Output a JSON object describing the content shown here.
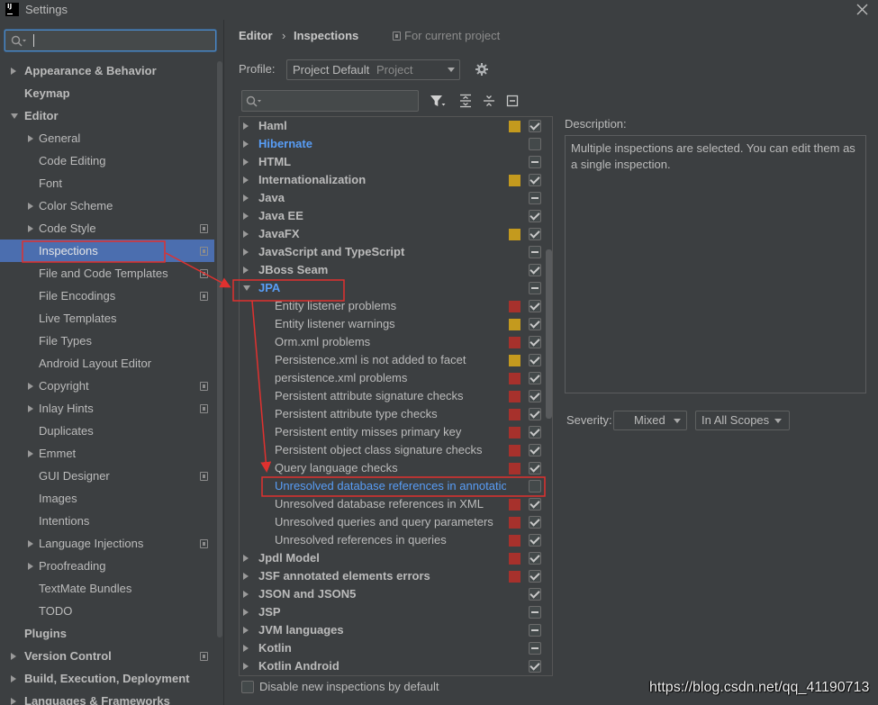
{
  "window": {
    "logo_text": "IJ",
    "title": "Settings"
  },
  "sidebar_search": {
    "value": ""
  },
  "sidebar": {
    "items": [
      {
        "label": "Appearance & Behavior",
        "level": 0,
        "state": "collapsed"
      },
      {
        "label": "Keymap",
        "level": 0
      },
      {
        "label": "Editor",
        "level": 0,
        "state": "expanded"
      },
      {
        "label": "General",
        "level": 1,
        "state": "collapsed"
      },
      {
        "label": "Code Editing",
        "level": 1
      },
      {
        "label": "Font",
        "level": 1
      },
      {
        "label": "Color Scheme",
        "level": 1,
        "state": "collapsed"
      },
      {
        "label": "Code Style",
        "level": 1,
        "state": "collapsed",
        "project_icon": true
      },
      {
        "label": "Inspections",
        "level": 1,
        "project_icon": true,
        "selected": true
      },
      {
        "label": "File and Code Templates",
        "level": 1,
        "project_icon": true
      },
      {
        "label": "File Encodings",
        "level": 1,
        "project_icon": true
      },
      {
        "label": "Live Templates",
        "level": 1
      },
      {
        "label": "File Types",
        "level": 1
      },
      {
        "label": "Android Layout Editor",
        "level": 1
      },
      {
        "label": "Copyright",
        "level": 1,
        "state": "collapsed",
        "project_icon": true
      },
      {
        "label": "Inlay Hints",
        "level": 1,
        "state": "collapsed",
        "project_icon": true
      },
      {
        "label": "Duplicates",
        "level": 1
      },
      {
        "label": "Emmet",
        "level": 1,
        "state": "collapsed"
      },
      {
        "label": "GUI Designer",
        "level": 1,
        "project_icon": true
      },
      {
        "label": "Images",
        "level": 1
      },
      {
        "label": "Intentions",
        "level": 1
      },
      {
        "label": "Language Injections",
        "level": 1,
        "state": "collapsed",
        "project_icon": true
      },
      {
        "label": "Proofreading",
        "level": 1,
        "state": "collapsed"
      },
      {
        "label": "TextMate Bundles",
        "level": 1
      },
      {
        "label": "TODO",
        "level": 1
      },
      {
        "label": "Plugins",
        "level": 0
      },
      {
        "label": "Version Control",
        "level": 0,
        "state": "collapsed",
        "project_icon": true
      },
      {
        "label": "Build, Execution, Deployment",
        "level": 0,
        "state": "collapsed"
      },
      {
        "label": "Languages & Frameworks",
        "level": 0,
        "state": "collapsed"
      }
    ]
  },
  "breadcrumb": {
    "parent": "Editor",
    "separator": "›",
    "current": "Inspections",
    "scope": "For current project"
  },
  "profile": {
    "label": "Profile:",
    "name": "Project Default",
    "kind": "Project"
  },
  "inspection_filter": {
    "value": ""
  },
  "inspections": {
    "rows": [
      {
        "label": "Haml",
        "level": 0,
        "state": "collapsed",
        "severity": "warning",
        "check": "checked"
      },
      {
        "label": "Hibernate",
        "level": 0,
        "state": "collapsed",
        "modified": true,
        "severity": "none",
        "check": "unchecked"
      },
      {
        "label": "HTML",
        "level": 0,
        "state": "collapsed",
        "severity": "none",
        "check": "mixed"
      },
      {
        "label": "Internationalization",
        "level": 0,
        "state": "collapsed",
        "severity": "warning",
        "check": "checked"
      },
      {
        "label": "Java",
        "level": 0,
        "state": "collapsed",
        "severity": "none",
        "check": "mixed"
      },
      {
        "label": "Java EE",
        "level": 0,
        "state": "collapsed",
        "severity": "none",
        "check": "checked"
      },
      {
        "label": "JavaFX",
        "level": 0,
        "state": "collapsed",
        "severity": "warning",
        "check": "checked"
      },
      {
        "label": "JavaScript and TypeScript",
        "level": 0,
        "state": "collapsed",
        "severity": "none",
        "check": "mixed"
      },
      {
        "label": "JBoss Seam",
        "level": 0,
        "state": "collapsed",
        "severity": "none",
        "check": "checked"
      },
      {
        "label": "JPA",
        "level": 0,
        "state": "expanded",
        "modified": true,
        "severity": "none",
        "check": "mixed"
      },
      {
        "label": "Entity listener problems",
        "level": 1,
        "severity": "error",
        "check": "checked"
      },
      {
        "label": "Entity listener warnings",
        "level": 1,
        "severity": "warning",
        "check": "checked"
      },
      {
        "label": "Orm.xml problems",
        "level": 1,
        "severity": "error",
        "check": "checked"
      },
      {
        "label": "Persistence.xml is not added to facet",
        "level": 1,
        "severity": "warning",
        "check": "checked"
      },
      {
        "label": "persistence.xml problems",
        "level": 1,
        "severity": "error",
        "check": "checked"
      },
      {
        "label": "Persistent attribute signature checks",
        "level": 1,
        "severity": "error",
        "check": "checked"
      },
      {
        "label": "Persistent attribute type checks",
        "level": 1,
        "severity": "error",
        "check": "checked"
      },
      {
        "label": "Persistent entity misses primary key",
        "level": 1,
        "severity": "error",
        "check": "checked"
      },
      {
        "label": "Persistent object class signature checks",
        "level": 1,
        "severity": "error",
        "check": "checked"
      },
      {
        "label": "Query language checks",
        "level": 1,
        "severity": "error",
        "check": "checked"
      },
      {
        "label": "Unresolved database references in annotatio",
        "level": 1,
        "modified": true,
        "severity": "none",
        "check": "unchecked"
      },
      {
        "label": "Unresolved database references in XML",
        "level": 1,
        "severity": "error",
        "check": "checked"
      },
      {
        "label": "Unresolved queries and query parameters",
        "level": 1,
        "severity": "error",
        "check": "checked"
      },
      {
        "label": "Unresolved references in queries",
        "level": 1,
        "severity": "error",
        "check": "checked"
      },
      {
        "label": "Jpdl Model",
        "level": 0,
        "state": "collapsed",
        "severity": "error",
        "check": "checked"
      },
      {
        "label": "JSF annotated elements errors",
        "level": 0,
        "state": "collapsed",
        "severity": "error",
        "check": "checked"
      },
      {
        "label": "JSON and JSON5",
        "level": 0,
        "state": "collapsed",
        "severity": "none",
        "check": "checked"
      },
      {
        "label": "JSP",
        "level": 0,
        "state": "collapsed",
        "severity": "none",
        "check": "mixed"
      },
      {
        "label": "JVM languages",
        "level": 0,
        "state": "collapsed",
        "severity": "none",
        "check": "mixed"
      },
      {
        "label": "Kotlin",
        "level": 0,
        "state": "collapsed",
        "severity": "none",
        "check": "mixed"
      },
      {
        "label": "Kotlin Android",
        "level": 0,
        "state": "collapsed",
        "severity": "none",
        "check": "checked"
      }
    ]
  },
  "description": {
    "label": "Description:",
    "text": "Multiple inspections are selected. You can edit them as a single inspection."
  },
  "severity": {
    "label": "Severity:",
    "value": "Mixed",
    "scope": "In All Scopes"
  },
  "footer": {
    "disable_new_label": "Disable new inspections by default",
    "disable_new_checked": false
  },
  "watermark": "https://blog.csdn.net/qq_41190713",
  "icons": {
    "app": "intellij-logo-icon",
    "close": "close-icon",
    "search": "search-icon",
    "gear": "gear-icon",
    "filter": "filter-icon",
    "expand_all": "expand-all-icon",
    "collapse_all": "collapse-all-icon",
    "reset": "minus-square-icon",
    "project_scope": "project-scope-icon"
  },
  "colors": {
    "background": "#3c3f41",
    "text": "#bbbbbb",
    "modified_text": "#589df6",
    "selection": "#4b6eaf",
    "warning": "#c49a1e",
    "error": "#a7312c",
    "annotation": "#e0312f",
    "focus_border": "#4a88c7"
  }
}
